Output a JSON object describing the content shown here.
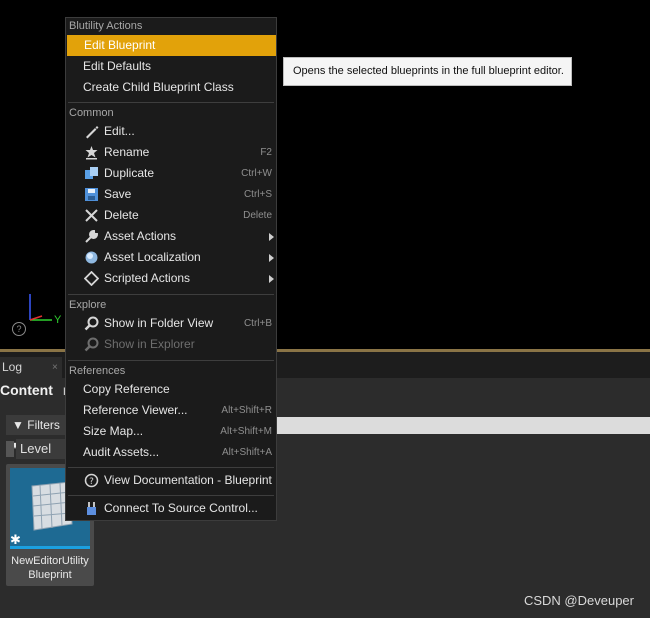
{
  "viewport": {
    "axis_label": "Y",
    "help_glyph": "?"
  },
  "tabs": {
    "log": "Log",
    "close": "×",
    "content": "Content",
    "content_suffix": "r"
  },
  "toolbar": {
    "filters": "Filters",
    "level": "Level"
  },
  "asset": {
    "name_line1": "NewEditorUtility",
    "name_line2": "Blueprint"
  },
  "menu": {
    "sections": {
      "blutility": "Blutility Actions",
      "common": "Common",
      "explore": "Explore",
      "references": "References"
    },
    "blutility_items": [
      {
        "label": "Edit Blueprint"
      },
      {
        "label": "Edit Defaults"
      },
      {
        "label": "Create Child Blueprint Class"
      }
    ],
    "common_items": [
      {
        "label": "Edit...",
        "icon": "pencil-icon",
        "shortcut": ""
      },
      {
        "label": "Rename",
        "icon": "rename-icon",
        "shortcut": "F2"
      },
      {
        "label": "Duplicate",
        "icon": "duplicate-icon",
        "shortcut": "Ctrl+W"
      },
      {
        "label": "Save",
        "icon": "save-icon",
        "shortcut": "Ctrl+S"
      },
      {
        "label": "Delete",
        "icon": "delete-icon",
        "shortcut": "Delete"
      },
      {
        "label": "Asset Actions",
        "icon": "wrench-icon",
        "shortcut": ""
      },
      {
        "label": "Asset Localization",
        "icon": "globe-icon",
        "shortcut": ""
      },
      {
        "label": "Scripted Actions",
        "icon": "diamond-icon",
        "shortcut": ""
      }
    ],
    "explore_items": [
      {
        "label": "Show in Folder View",
        "icon": "magnifier-icon",
        "shortcut": "Ctrl+B"
      },
      {
        "label": "Show in Explorer",
        "icon": "magnifier-icon",
        "shortcut": ""
      }
    ],
    "reference_items": [
      {
        "label": "Copy Reference",
        "shortcut": ""
      },
      {
        "label": "Reference Viewer...",
        "shortcut": "Alt+Shift+R"
      },
      {
        "label": "Size Map...",
        "shortcut": "Alt+Shift+M"
      },
      {
        "label": "Audit Assets...",
        "shortcut": "Alt+Shift+A"
      }
    ],
    "documentation": {
      "label": "View Documentation - Blueprint",
      "icon": "help-circle-icon"
    },
    "source_control": {
      "label": "Connect To Source Control...",
      "icon": "source-control-icon"
    }
  },
  "tooltip": {
    "text": "Opens the selected blueprints in the full blueprint editor."
  },
  "watermark": "CSDN @Deveuper",
  "colors": {
    "highlight": "#e2a20a",
    "menu_bg": "#1b1b1b",
    "tooltip_bg": "#f5f5f5"
  }
}
